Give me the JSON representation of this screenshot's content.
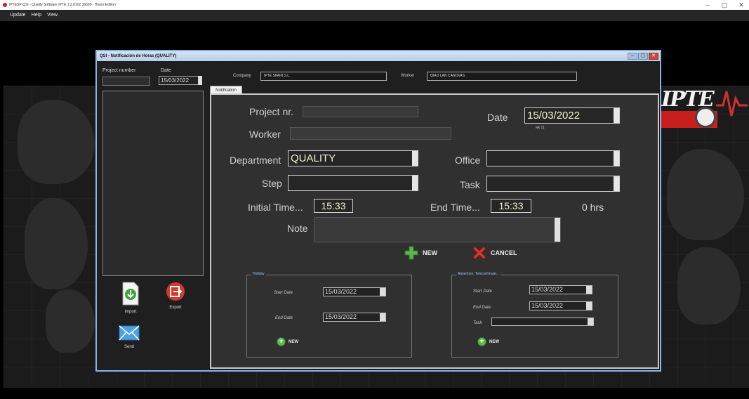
{
  "os_window": {
    "title": "IPTESP QSI - Quality Software IPTE 1.2.8102.36690 - Hours Edition",
    "controls": [
      "–",
      "▢",
      "✕"
    ]
  },
  "menubar": {
    "items": [
      "Update",
      "Help",
      "View"
    ]
  },
  "dialog": {
    "title": "QSI - Notificación de Horas (QUALITY)",
    "left": {
      "project_number_label": "Project number",
      "date_label": "Date",
      "date_value": "15/03/2022",
      "import_label": "Import",
      "export_label": "Export",
      "send_label": "Send"
    },
    "top": {
      "company_label": "Company",
      "company_value": "IPTE SPAIN S.L.",
      "worker_label": "Worker",
      "worker_value": "QIAO LAN CANOVAS"
    },
    "tab_label": "Notification",
    "form": {
      "project_label": "Project nr.",
      "worker_label": "Worker",
      "date_label": "Date",
      "date_value": "15/03/2022",
      "date_hint": "wk 11",
      "department_label": "Department",
      "department_value": "QUALITY",
      "office_label": "Office",
      "step_label": "Step",
      "task_label": "Task",
      "initial_time_label": "Initial Time...",
      "initial_time_value": "15:33",
      "end_time_label": "End Time...",
      "end_time_value": "15:33",
      "hours_value": "0  hrs",
      "note_label": "Note",
      "new_label": "NEW",
      "cancel_label": "CANCEL"
    },
    "holiday": {
      "title": "Holiday",
      "start_label": "Start Date",
      "start_value": "15/03/2022",
      "end_label": "End Date",
      "end_value": "15/03/2022",
      "new_label": "NEW"
    },
    "absence": {
      "title": "Absention, Telecommute...",
      "start_label": "Start Date",
      "start_value": "15/03/2022",
      "end_label": "End Date",
      "end_value": "15/03/2022",
      "task_label": "Task",
      "new_label": "NEW"
    }
  },
  "colors": {
    "dialog_border": "#8ab4e8",
    "select_text": "#f0f0c8",
    "brand_red": "#c81e1e",
    "plus_green": "#5db84c",
    "cancel_red": "#d33a2c"
  }
}
